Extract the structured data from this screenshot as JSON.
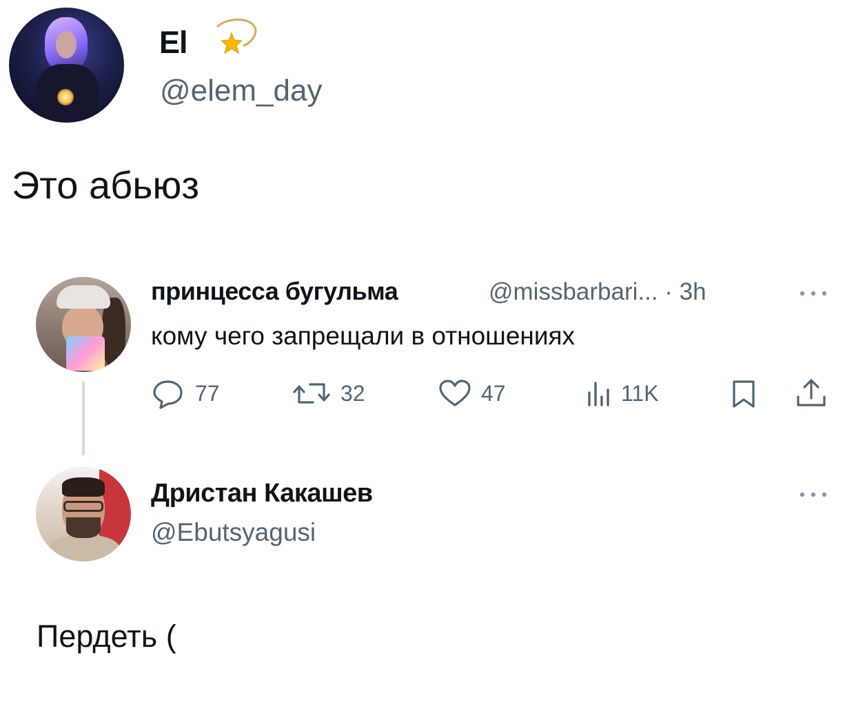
{
  "author": {
    "display_name": "El",
    "handle": "@elem_day"
  },
  "tweet": {
    "text": "Это абьюз"
  },
  "quoted_tweet": {
    "display_name": "принцесса бугульма",
    "handle_time": "@missbarbari... · 3h",
    "text": "кому чего запрещали в отношениях",
    "replies": "77",
    "retweets": "32",
    "likes": "47",
    "views": "11K"
  },
  "reply_tweet": {
    "display_name": "Дристан Какашев",
    "handle": "@Ebutsyagusi",
    "text": "Пердеть ("
  },
  "icons": {
    "badge": "shooting-star-icon",
    "more": "more-dots-icon",
    "reply": "reply-bubble-icon",
    "retweet": "retweet-icon",
    "like": "heart-icon",
    "views": "views-chart-icon",
    "bookmark": "bookmark-icon",
    "share": "share-icon"
  },
  "colors": {
    "text": "#0f1419",
    "secondary": "#536471",
    "thread_line": "#cfd9de",
    "star": "#f5b800"
  }
}
